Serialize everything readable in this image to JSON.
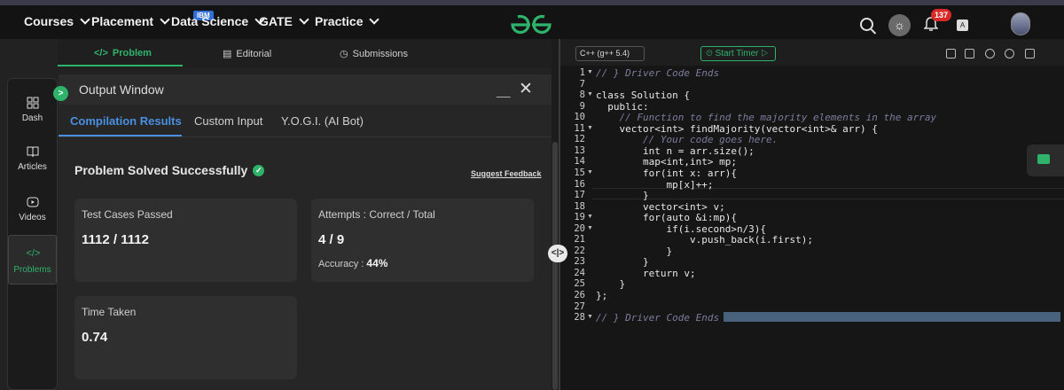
{
  "topnav": {
    "items": [
      {
        "label": "Courses"
      },
      {
        "label": "Placement"
      },
      {
        "label": "Data Science"
      },
      {
        "label": "GATE"
      },
      {
        "label": "Practice"
      }
    ],
    "badge": "IBM",
    "notification_count": "137",
    "colors": {
      "accent": "#2fb36b",
      "notification": "#d92a2a"
    }
  },
  "problem_tabs": {
    "problem": "Problem",
    "editorial": "Editorial",
    "submissions": "Submissions"
  },
  "sidebar": {
    "items": [
      {
        "label": "Dash",
        "icon": "dashboard-icon"
      },
      {
        "label": "Articles",
        "icon": "book-icon"
      },
      {
        "label": "Videos",
        "icon": "video-icon"
      },
      {
        "label": "Problems",
        "icon": "code-icon"
      }
    ]
  },
  "output_window": {
    "title": "Output Window",
    "toggle": ">",
    "minimize": "__",
    "close": "✕",
    "tabs": [
      {
        "label": "Compilation Results"
      },
      {
        "label": "Custom Input"
      },
      {
        "label": "Y.O.G.I. (AI Bot)"
      }
    ],
    "status": "Problem Solved Successfully",
    "feedback_link": "Suggest Feedback",
    "cards": {
      "test_cases": {
        "label": "Test Cases Passed",
        "value": "1112 / 1112"
      },
      "attempts": {
        "label": "Attempts : Correct / Total",
        "value": "4 / 9",
        "accuracy_label": "Accuracy :",
        "accuracy_value": "44%"
      },
      "time": {
        "label": "Time Taken",
        "value": "0.74"
      }
    }
  },
  "editor": {
    "language": "C++ (g++ 5.4)",
    "timer_label": "Start Timer",
    "lines": [
      {
        "num": "1",
        "text": "// } Driver Code Ends",
        "type": "comment",
        "fold": true
      },
      {
        "num": "7",
        "text": "",
        "type": "code"
      },
      {
        "num": "8",
        "text": "class Solution {",
        "type": "code",
        "fold": true
      },
      {
        "num": "9",
        "text": "  public:",
        "type": "code"
      },
      {
        "num": "10",
        "text": "    // Function to find the majority elements in the array",
        "type": "comment"
      },
      {
        "num": "11",
        "text": "    vector<int> findMajority(vector<int>& arr) {",
        "type": "code",
        "fold": true
      },
      {
        "num": "12",
        "text": "        // Your code goes here.",
        "type": "comment"
      },
      {
        "num": "13",
        "text": "        int n = arr.size();",
        "type": "code"
      },
      {
        "num": "14",
        "text": "        map<int,int> mp;",
        "type": "code"
      },
      {
        "num": "15",
        "text": "        for(int x: arr){",
        "type": "code",
        "fold": true
      },
      {
        "num": "16",
        "text": "            mp[x]++;",
        "type": "code"
      },
      {
        "num": "17",
        "text": "        }",
        "type": "code"
      },
      {
        "num": "18",
        "text": "        vector<int> v;",
        "type": "code"
      },
      {
        "num": "19",
        "text": "        for(auto &i:mp){",
        "type": "code",
        "fold": true
      },
      {
        "num": "20",
        "text": "            if(i.second>n/3){",
        "type": "code",
        "fold": true
      },
      {
        "num": "21",
        "text": "                v.push_back(i.first);",
        "type": "code"
      },
      {
        "num": "22",
        "text": "            }",
        "type": "code"
      },
      {
        "num": "23",
        "text": "        }",
        "type": "code"
      },
      {
        "num": "24",
        "text": "        return v;",
        "type": "code"
      },
      {
        "num": "25",
        "text": "    }",
        "type": "code"
      },
      {
        "num": "26",
        "text": "};",
        "type": "code"
      },
      {
        "num": "27",
        "text": "",
        "type": "code"
      },
      {
        "num": "28",
        "text": "// } Driver Code Ends",
        "type": "comment",
        "fold": true
      }
    ]
  }
}
